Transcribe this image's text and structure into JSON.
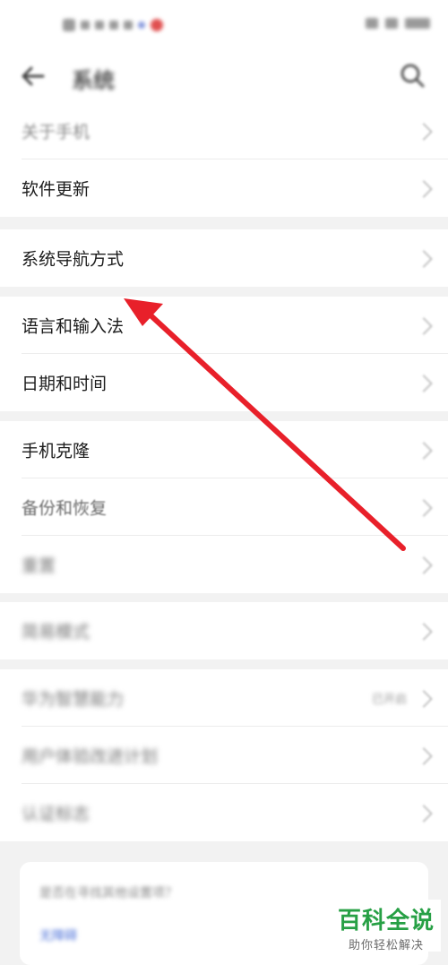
{
  "header": {
    "title": "系统"
  },
  "groups": [
    {
      "items": [
        {
          "label": "关于手机"
        },
        {
          "label": "软件更新"
        }
      ]
    },
    {
      "items": [
        {
          "label": "系统导航方式"
        }
      ]
    },
    {
      "items": [
        {
          "label": "语言和输入法"
        },
        {
          "label": "日期和时间"
        }
      ]
    },
    {
      "items": [
        {
          "label": "手机克隆"
        },
        {
          "label": "备份和恢复"
        },
        {
          "label": "重置"
        }
      ]
    },
    {
      "items": [
        {
          "label": "简易模式"
        }
      ]
    },
    {
      "items": [
        {
          "label": "华为智慧能力",
          "value": "已开启"
        },
        {
          "label": "用户体验改进计划"
        },
        {
          "label": "认证标志"
        }
      ]
    }
  ],
  "tip": {
    "text": "是否在寻找其他设置项？",
    "link": "无障碍"
  },
  "watermark": {
    "main": "百科全说",
    "sub": "助你轻松解决"
  },
  "colors": {
    "annotation_arrow": "#e8202a",
    "watermark_green": "#27a045",
    "link_blue": "#4a6fd8"
  }
}
